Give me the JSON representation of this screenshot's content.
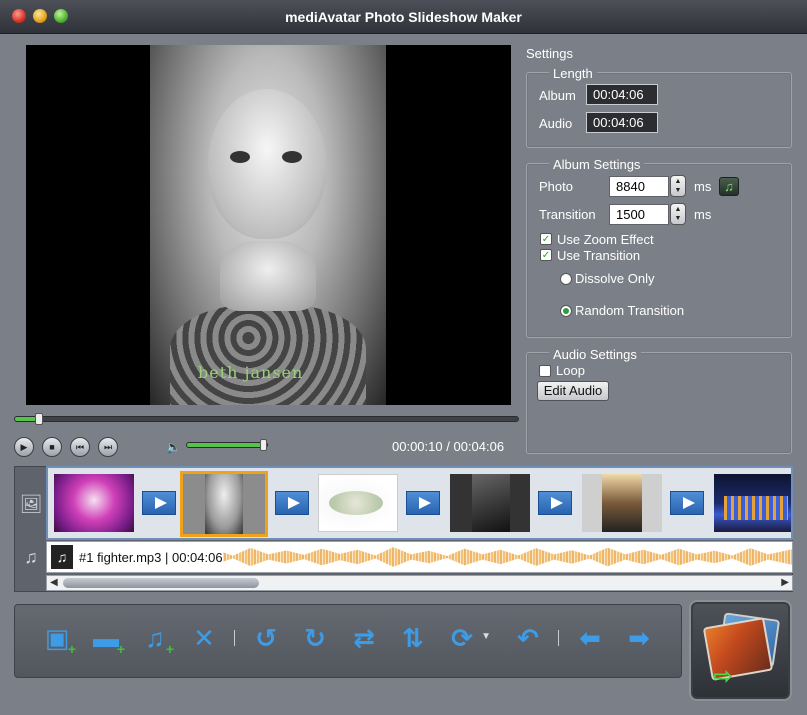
{
  "window": {
    "title": "mediAvatar Photo Slideshow Maker"
  },
  "preview": {
    "watermark": "beth jansen"
  },
  "playback": {
    "position_fraction": 0.048,
    "volume_fraction": 0.95,
    "current_time": "00:00:10",
    "separator": "/",
    "total_time": "00:04:06"
  },
  "settings": {
    "title": "Settings",
    "length": {
      "legend": "Length",
      "album_label": "Album",
      "album_value": "00:04:06",
      "audio_label": "Audio",
      "audio_value": "00:04:06"
    },
    "album": {
      "legend": "Album Settings",
      "photo_label": "Photo",
      "photo_value": "8840",
      "photo_unit": "ms",
      "transition_label": "Transition",
      "transition_value": "1500",
      "transition_unit": "ms",
      "zoom_label": "Use Zoom Effect",
      "zoom_checked": true,
      "use_transition_label": "Use Transition",
      "use_transition_checked": true,
      "dissolve_label": "Dissolve Only",
      "random_label": "Random Transition",
      "selected_transition": "random"
    },
    "audio": {
      "legend": "Audio Settings",
      "loop_label": "Loop",
      "loop_checked": false,
      "edit_label": "Edit Audio"
    }
  },
  "timeline": {
    "photos": [
      "pink-orchid",
      "girl-portrait",
      "white-tulips",
      "dark-text-card",
      "model-portrait",
      "night-building"
    ],
    "selected_index": 1,
    "audio": {
      "label": "#1 fighter.mp3 | 00:04:06"
    }
  },
  "toolbar": {
    "buttons": [
      "add-photo-icon",
      "add-folder-icon",
      "add-music-icon",
      "delete-icon",
      "rotate-left-icon",
      "rotate-right-icon",
      "swap-icon",
      "sort-icon",
      "refresh-dropdown-icon",
      "undo-icon",
      "move-left-icon",
      "move-right-icon"
    ]
  },
  "colors": {
    "accent": "#57c24a",
    "toolbar_icon": "#3e9be6",
    "selection": "#f0a31a"
  }
}
